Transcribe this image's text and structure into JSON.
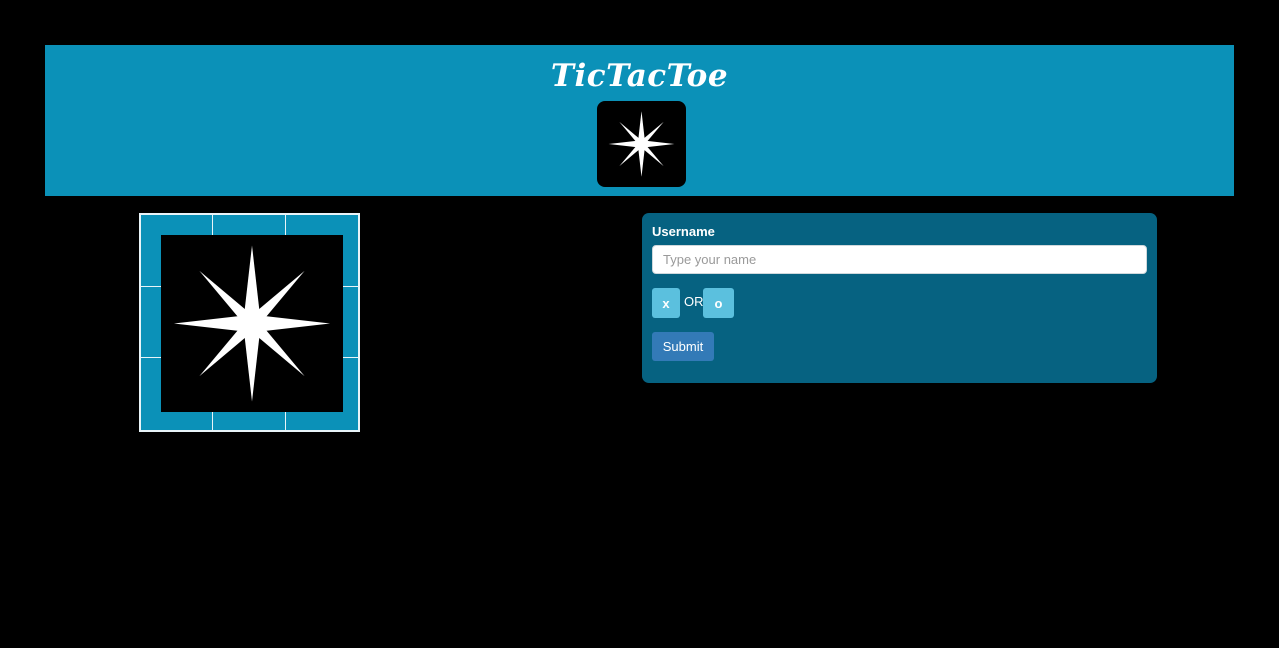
{
  "header": {
    "title": "TicTacToe",
    "logo_icon": "compass-star-icon",
    "background_color": "#0b91b8"
  },
  "board": {
    "rows": 3,
    "cols": 3,
    "cells": [
      "",
      "",
      "",
      "",
      "",
      "",
      "",
      "",
      ""
    ],
    "overlay_icon": "compass-star-icon",
    "cell_color": "#0b91b8"
  },
  "form": {
    "username_label": "Username",
    "username_placeholder": "Type your name",
    "username_value": "",
    "choice_x_label": "x",
    "or_text": "OR",
    "choice_o_label": "o",
    "submit_label": "Submit",
    "panel_color": "#066281",
    "choice_color": "#5bc0de",
    "submit_color": "#337ab7"
  }
}
